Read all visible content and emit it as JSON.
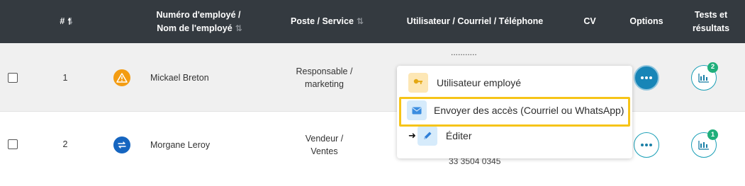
{
  "headers": {
    "num": "#",
    "employee_line1": "Numéro d'employé /",
    "employee_line2": "Nom de l'employé",
    "position": "Poste / Service",
    "user": "Utilisateur / Courriel / Téléphone",
    "cv": "CV",
    "options": "Options",
    "tests_line1": "Tests et",
    "tests_line2": "résultats"
  },
  "rows": [
    {
      "num": "1",
      "status_icon": "warning-icon",
      "status_color": "#f39c12",
      "name": "Mickael Breton",
      "position_line1": "Responsable /",
      "position_line2": "marketing",
      "user_peek": "...........",
      "tests_count": "2"
    },
    {
      "num": "2",
      "status_icon": "sync-icon",
      "status_color": "#1565c0",
      "name": "Morgane Leroy",
      "position_line1": "Vendeur /",
      "position_line2": "Ventes",
      "user_peek": "33 3504 0345",
      "tests_count": "1"
    }
  ],
  "options_menu": {
    "items": [
      {
        "label": "Utilisateur employé",
        "icon": "key-icon"
      },
      {
        "label": "Envoyer des accès (Courriel ou WhatsApp)",
        "icon": "envelope-icon"
      },
      {
        "label": "Éditer",
        "icon": "pencil-icon"
      }
    ]
  },
  "colors": {
    "header_bg": "#343a40",
    "accent": "#1a9fb6",
    "badge": "#1fae7a",
    "highlight": "#f6c418"
  }
}
